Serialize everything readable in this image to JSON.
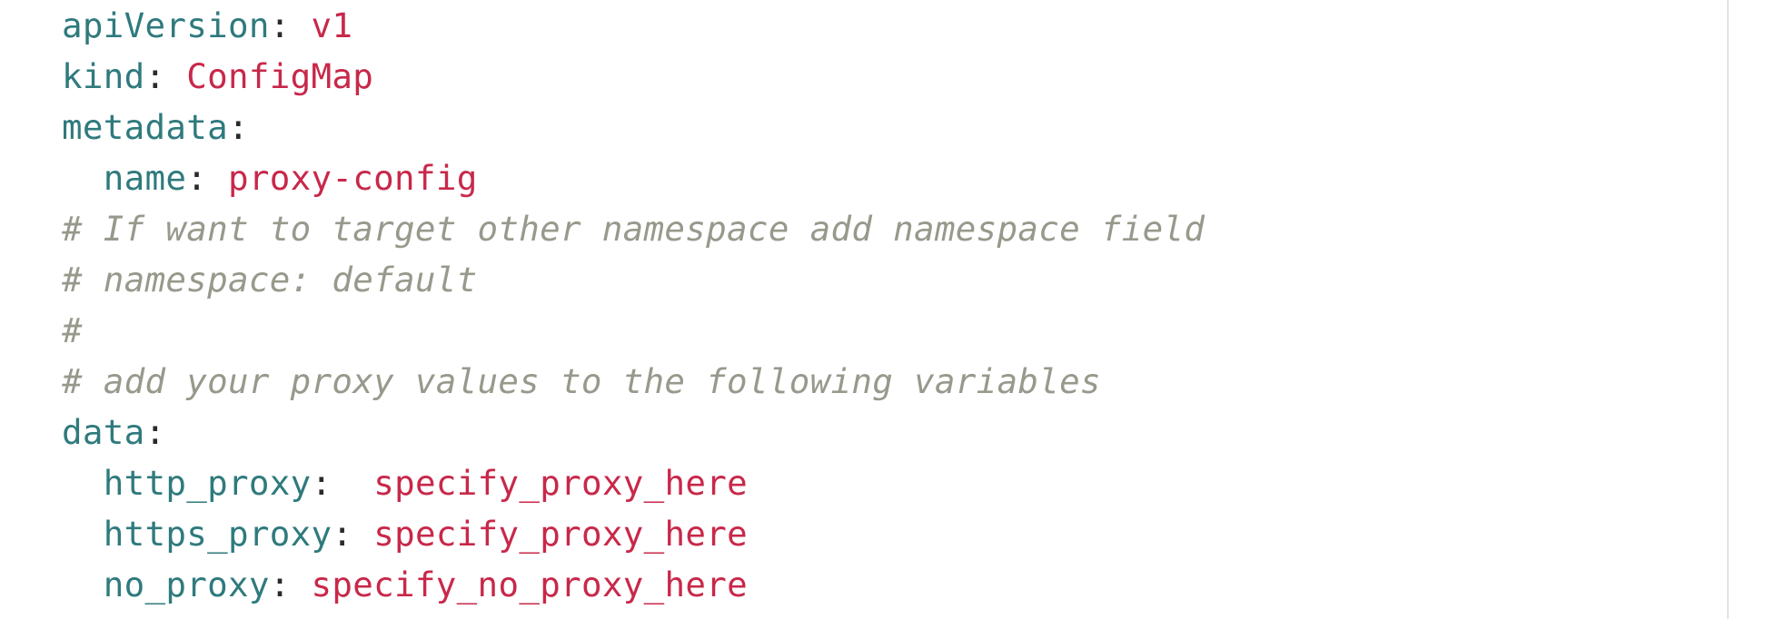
{
  "code": {
    "lines": [
      {
        "indent": "",
        "key": "apiVersion",
        "sep": ": ",
        "value": "v1"
      },
      {
        "indent": "",
        "key": "kind",
        "sep": ": ",
        "value": "ConfigMap"
      },
      {
        "indent": "",
        "key": "metadata",
        "sep": ":",
        "value": ""
      },
      {
        "indent": "  ",
        "key": "name",
        "sep": ": ",
        "value": "proxy-config"
      },
      {
        "comment": "# If want to target other namespace add namespace field"
      },
      {
        "comment": "# namespace: default"
      },
      {
        "comment": "#"
      },
      {
        "comment": "# add your proxy values to the following variables"
      },
      {
        "indent": "",
        "key": "data",
        "sep": ":",
        "value": ""
      },
      {
        "indent": "  ",
        "key": "http_proxy",
        "sep": ":  ",
        "value": "specify_proxy_here"
      },
      {
        "indent": "  ",
        "key": "https_proxy",
        "sep": ": ",
        "value": "specify_proxy_here"
      },
      {
        "indent": "  ",
        "key": "no_proxy",
        "sep": ": ",
        "value": "specify_no_proxy_here"
      }
    ]
  },
  "colors": {
    "key": "#2f7a7d",
    "value": "#c8284a",
    "comment": "#98998c",
    "background": "#ffffff",
    "border": "#e3e3e3"
  }
}
